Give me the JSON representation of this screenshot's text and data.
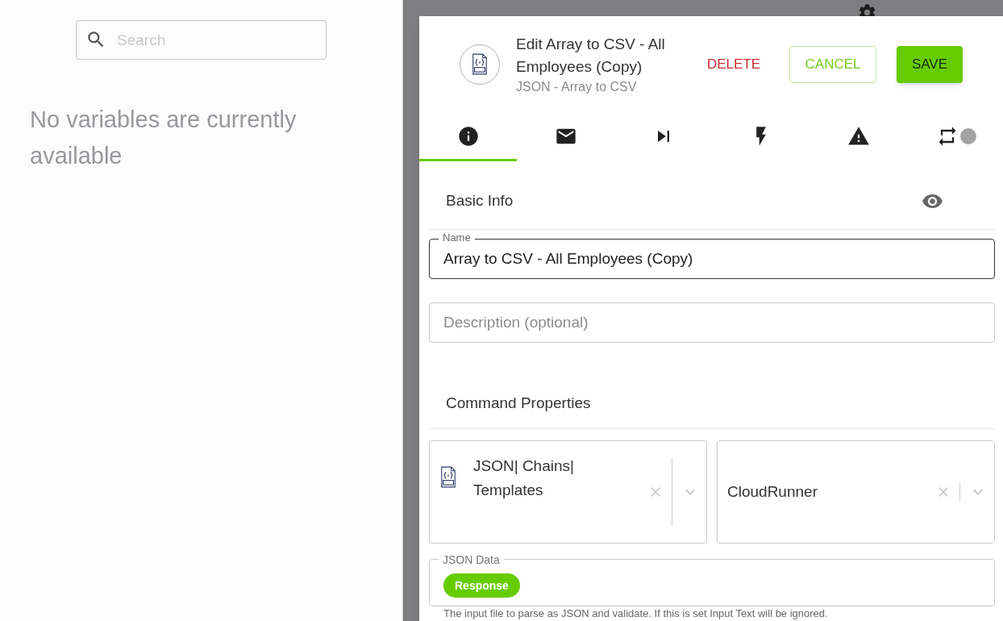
{
  "sidebar": {
    "search": {
      "placeholder": "Search"
    },
    "empty_message": "No variables are currently available"
  },
  "dialog": {
    "title": "Edit Array to CSV - All Employees (Copy)",
    "subtitle": "JSON - Array to CSV",
    "buttons": [
      {
        "label": "DELETE",
        "kind": "text"
      },
      {
        "label": "CANCEL",
        "kind": "outlined"
      },
      {
        "label": "SAVE",
        "kind": "filled"
      }
    ],
    "tabs": [
      {
        "kind": "info",
        "selected": true
      },
      {
        "kind": "mail",
        "selected": false
      },
      {
        "kind": "skip",
        "selected": false
      },
      {
        "kind": "flash",
        "selected": false
      },
      {
        "kind": "warning",
        "selected": false
      },
      {
        "kind": "repeat",
        "selected": false
      }
    ],
    "basic_info": {
      "title": "Basic Info",
      "name_field": {
        "label": "Name",
        "value": "Array to CSV - All Employees (Copy)"
      },
      "description_field": {
        "placeholder": "Description (optional)"
      }
    },
    "command_properties": {
      "title": "Command Properties",
      "selects": [
        {
          "kind": "json-file",
          "value": "JSON| Chains| Templates"
        },
        {
          "kind": "plain",
          "value": "CloudRunner"
        }
      ],
      "json_data": {
        "label": "JSON Data",
        "chips": [
          "Response"
        ]
      },
      "help_text": "The input file to parse as JSON and validate. If this is set Input Text will be ignored."
    }
  }
}
